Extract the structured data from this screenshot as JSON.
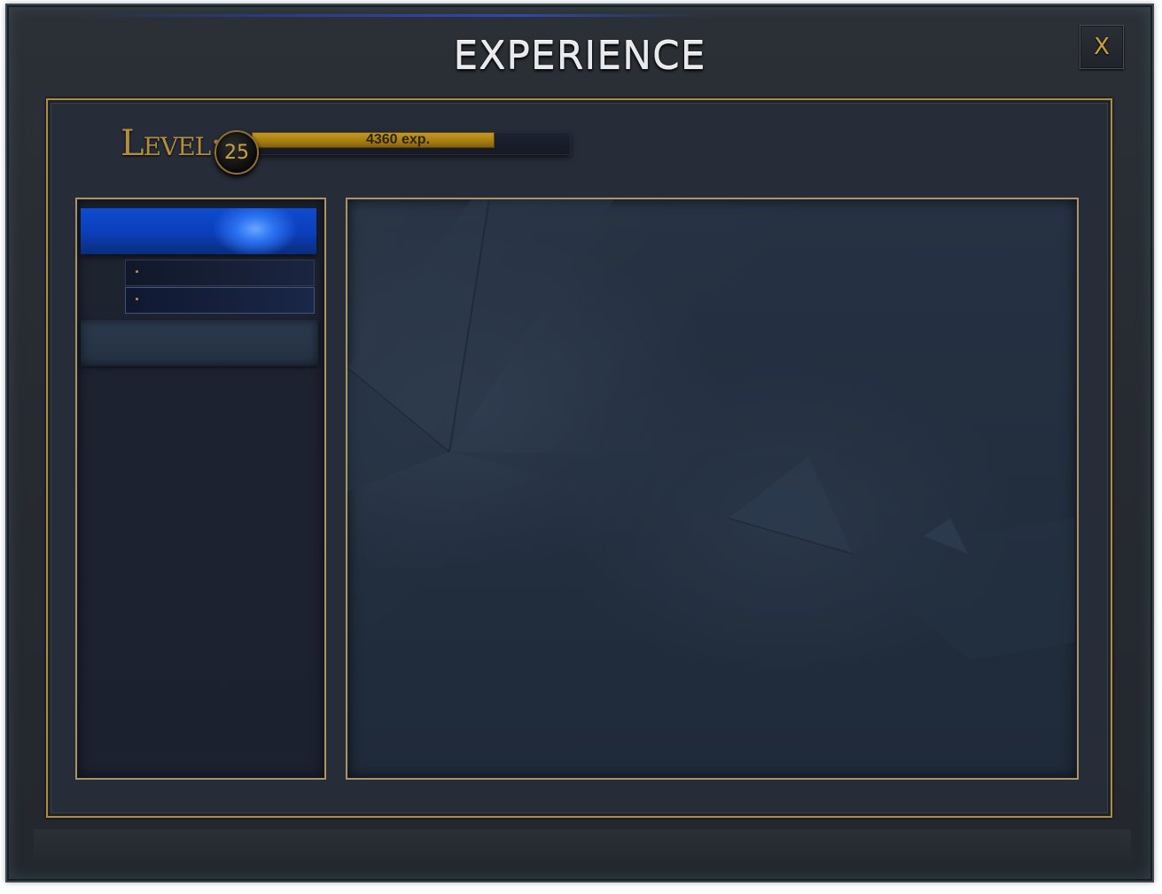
{
  "window": {
    "title": "EXPERIENCE",
    "close_label": "X"
  },
  "level": {
    "label": "Level:",
    "value": "25",
    "exp_text": "4360 exp.",
    "progress_fraction": 0.76
  },
  "categories": [
    {
      "state": "active",
      "items": [
        {
          "label": ""
        },
        {
          "label": ""
        }
      ]
    },
    {
      "state": "inactive",
      "items": []
    }
  ],
  "colors": {
    "gold_accent": "#b08d3e",
    "active_blue": "#0e4bd1",
    "panel_bg": "#1f2a3a"
  }
}
